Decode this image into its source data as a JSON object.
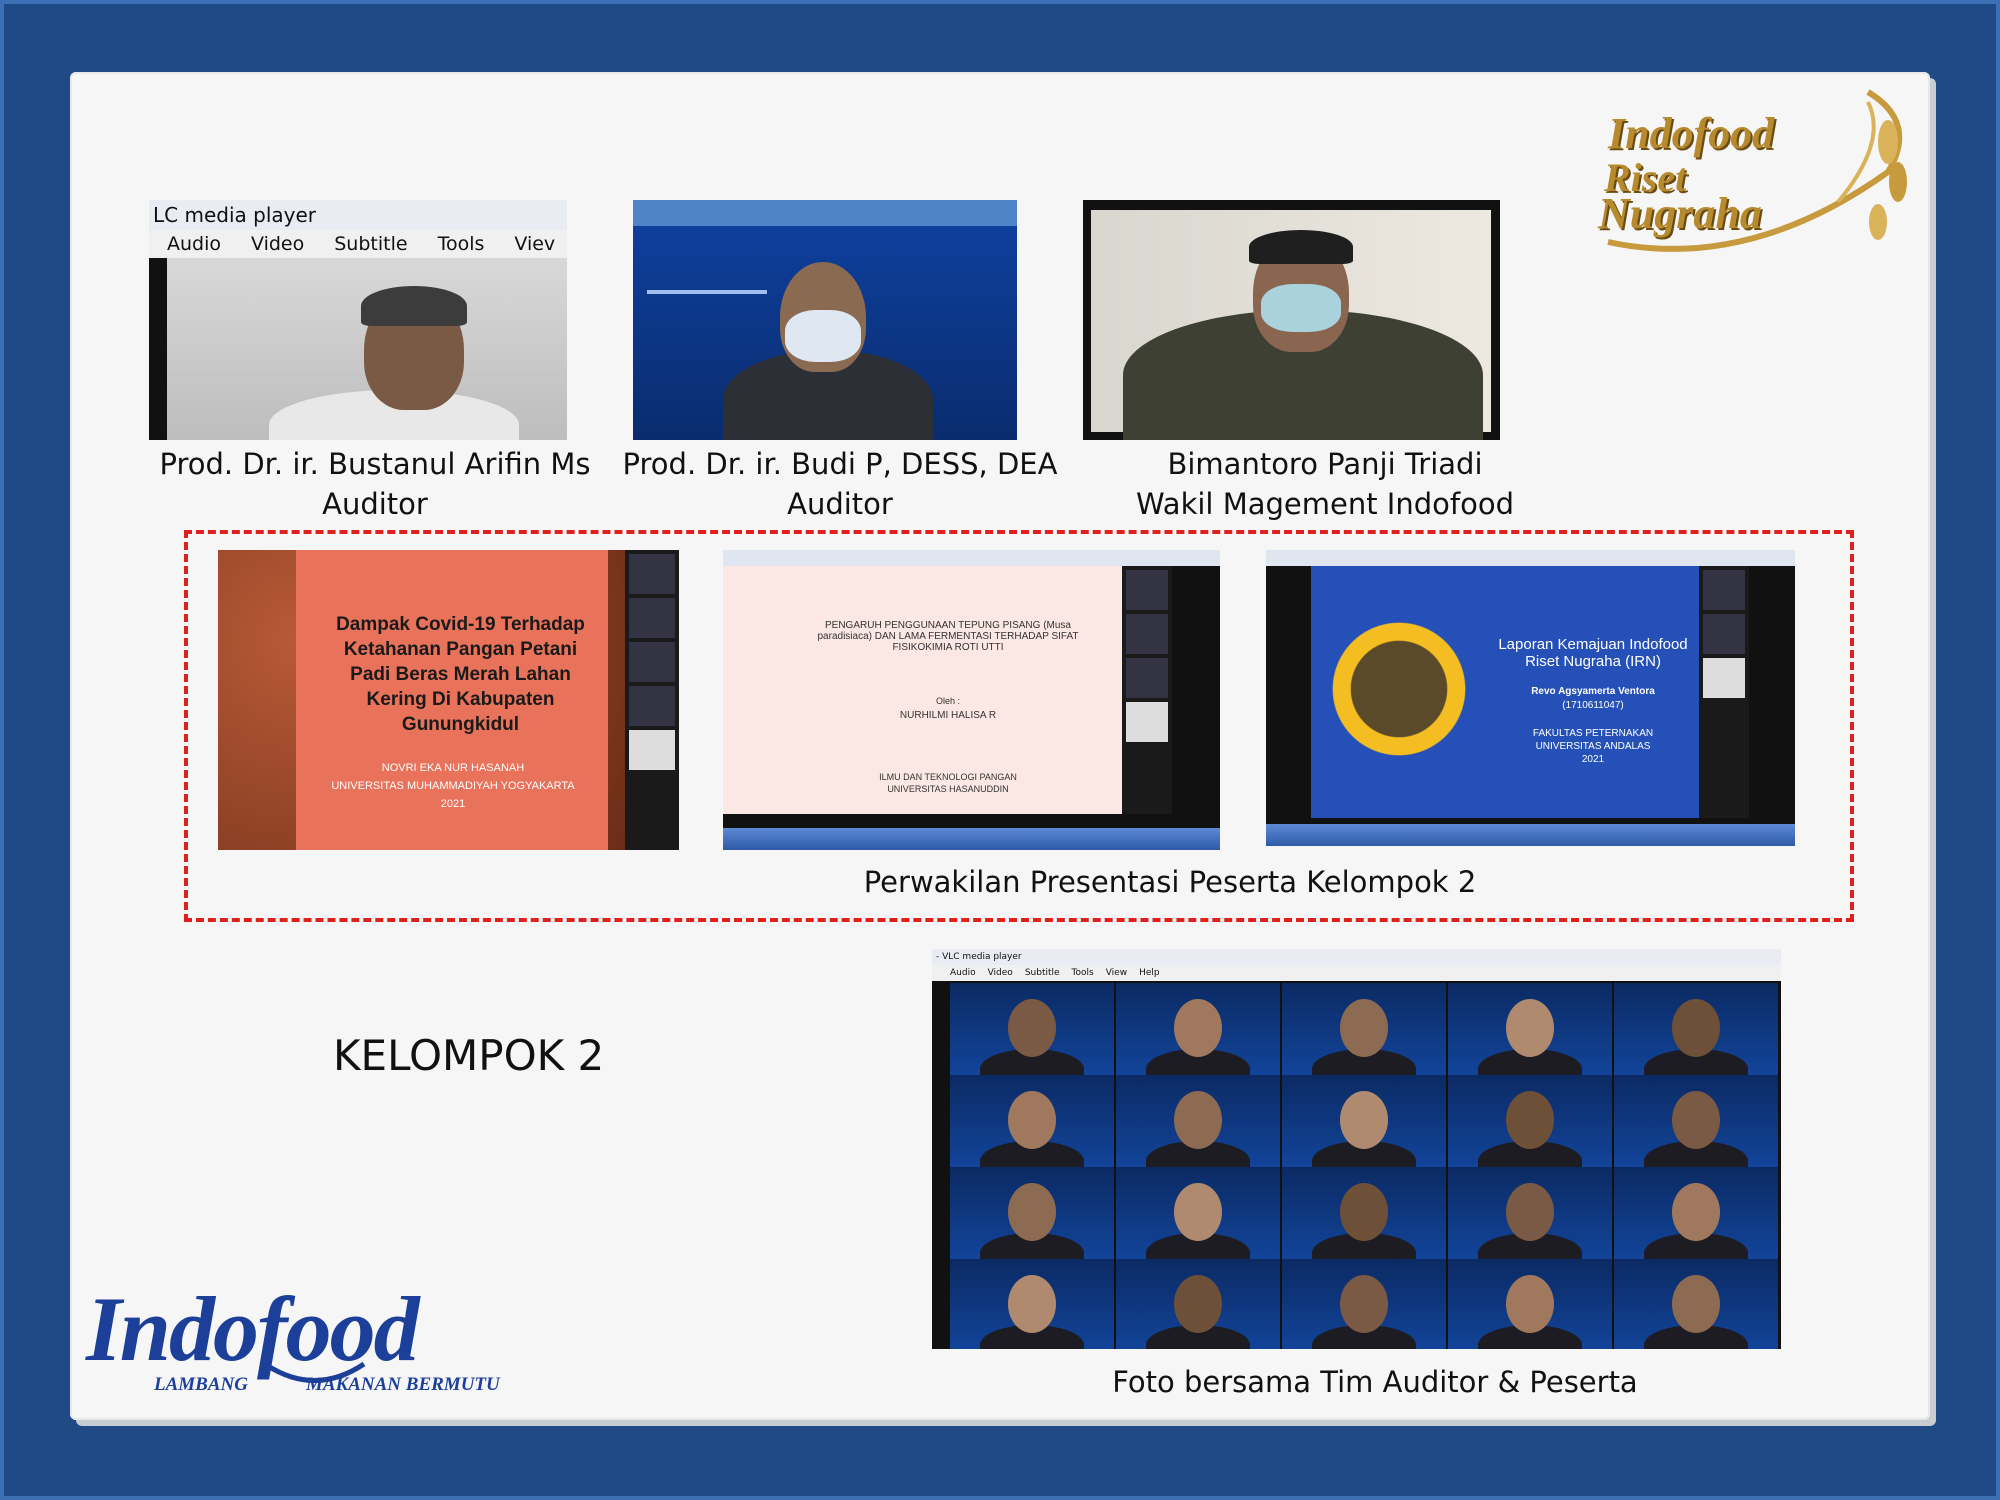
{
  "auditors": [
    {
      "name": "Prod. Dr. ir. Bustanul Arifin Ms",
      "role": "Auditor"
    },
    {
      "name": "Prod. Dr. ir. Budi P, DESS, DEA",
      "role": "Auditor"
    },
    {
      "name": "Bimantoro Panji Triadi",
      "role": "Wakil Magement Indofood"
    }
  ],
  "vlc": {
    "title": "LC media player",
    "menu": [
      "Audio",
      "Video",
      "Subtitle",
      "Tools",
      "Viev"
    ]
  },
  "presentations": {
    "caption": "Perwakilan Presentasi Peserta Kelompok 2",
    "p1": {
      "title": "Dampak Covid-19 Terhadap Ketahanan Pangan Petani Padi Beras Merah Lahan Kering Di Kabupaten Gunungkidul",
      "author": "NOVRI EKA NUR HASANAH",
      "univ": "UNIVERSITAS MUHAMMADIYAH YOGYAKARTA",
      "year": "2021"
    },
    "p2": {
      "title": "PENGARUH PENGGUNAAN TEPUNG PISANG (Musa paradisiaca) DAN LAMA FERMENTASI TERHADAP SIFAT FISIKOKIMIA ROTI UTTI",
      "by": "Oleh :",
      "author": "NURHILMI HALISA R",
      "dept": "ILMU DAN TEKNOLOGI PANGAN",
      "univ": "UNIVERSITAS HASANUDDIN"
    },
    "p3": {
      "title": "Laporan Kemajuan Indofood Riset Nugraha (IRN)",
      "author": "Revo Agsyamerta Ventora",
      "nim": "(1710611047)",
      "fac": "FAKULTAS PETERNAKAN",
      "univ": "UNIVERSITAS ANDALAS",
      "year": "2021"
    }
  },
  "group_label": "KELOMPOK 2",
  "group_photo": {
    "caption": "Foto bersama Tim Auditor & Peserta",
    "title": "- VLC media player",
    "menu": [
      "Audio",
      "Video",
      "Subtitle",
      "Tools",
      "View",
      "Help"
    ]
  },
  "brand": {
    "irn": [
      "Indofood",
      "Riset",
      "Nugraha"
    ],
    "indofood": "Indofood",
    "tagline_left": "LAMBANG",
    "tagline_right": "MAKANAN BERMUTU"
  },
  "colors": {
    "background": "#1f4a86",
    "dash": "#e01f1f",
    "brand_blue": "#1c3f9a",
    "gold": "#b88a2e"
  }
}
